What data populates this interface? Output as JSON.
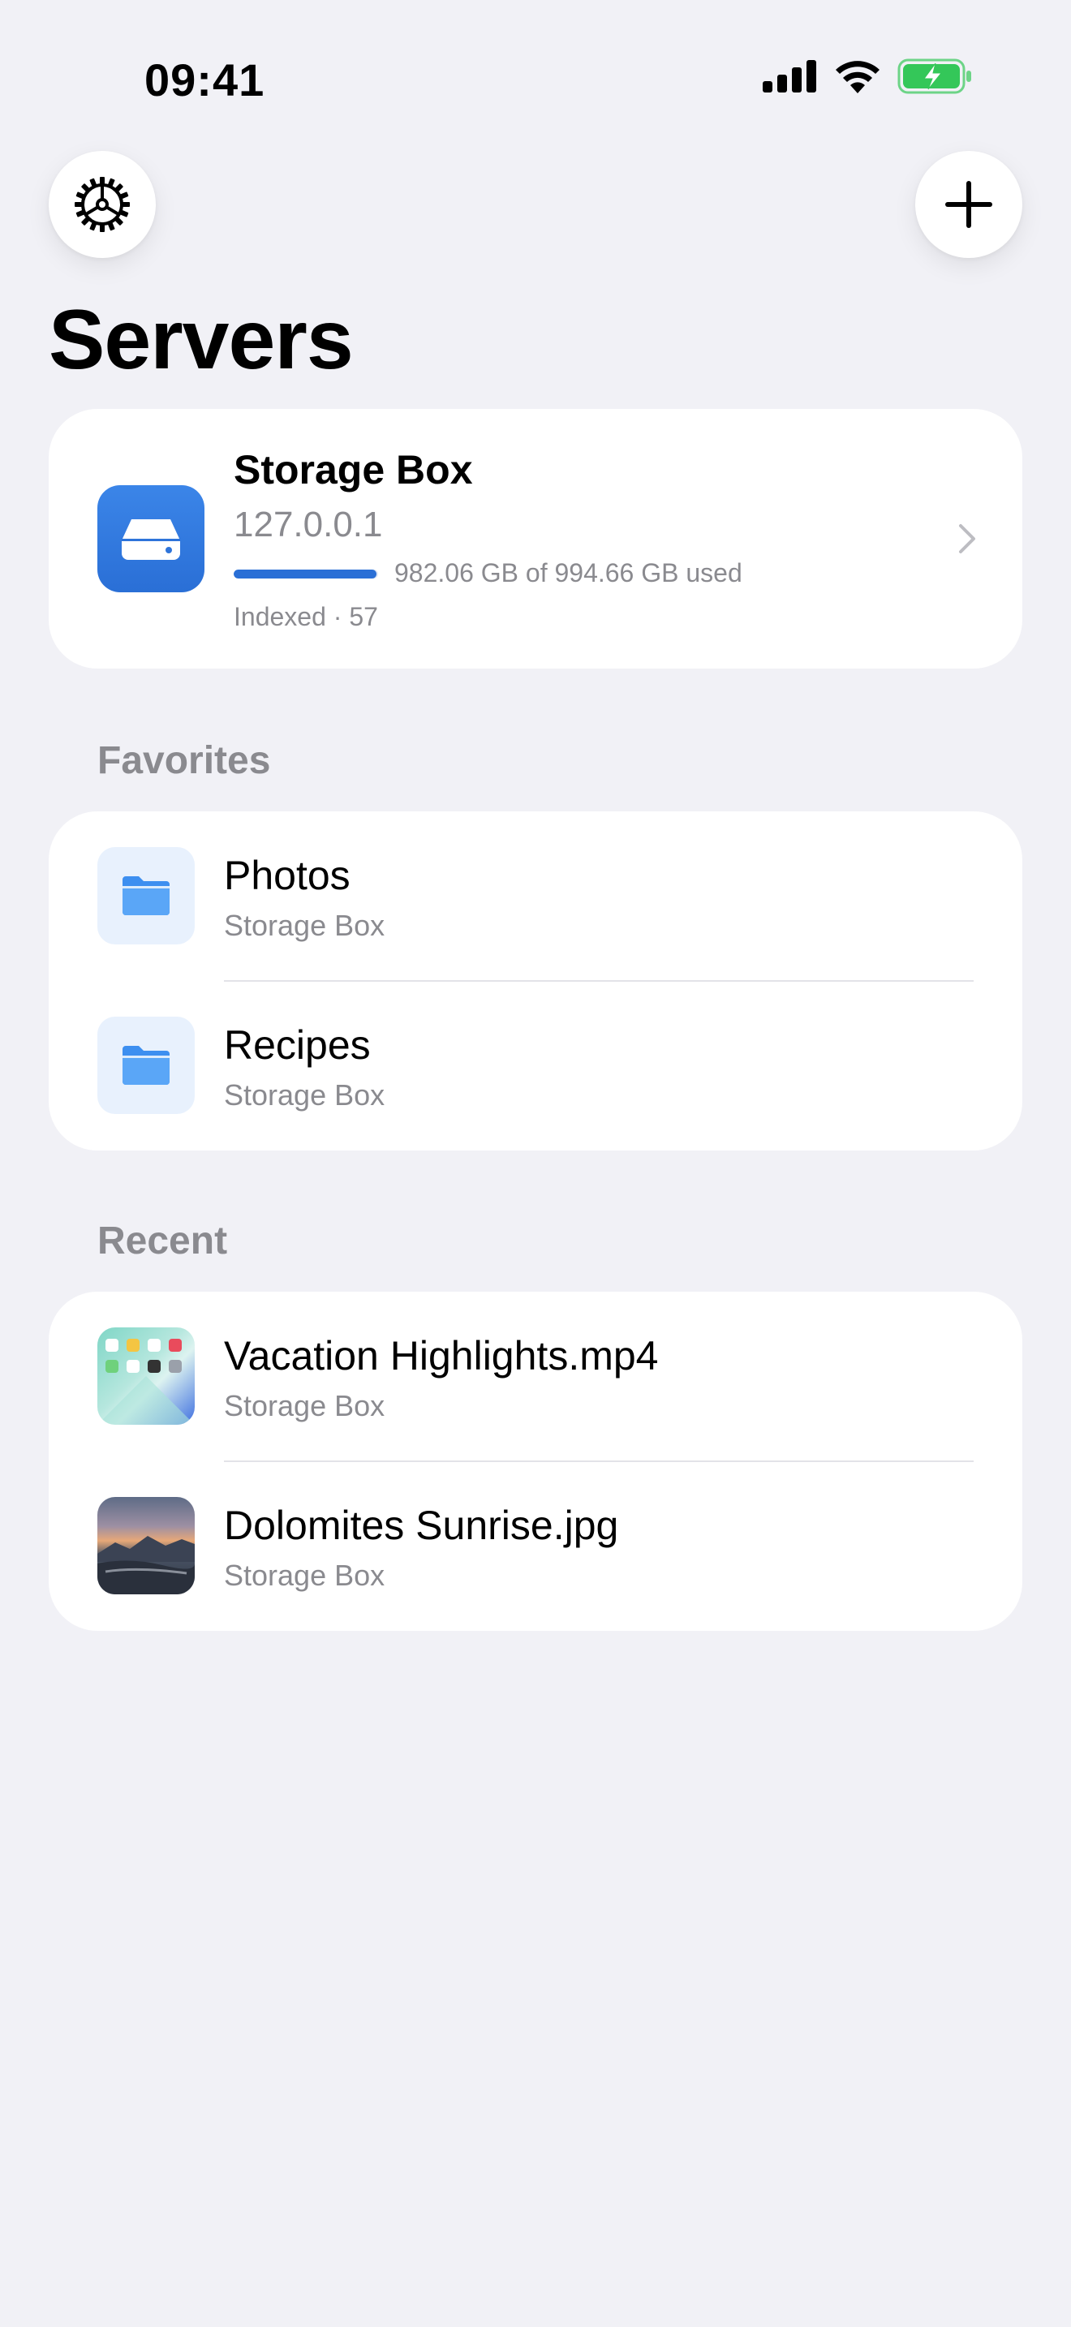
{
  "status_bar": {
    "time": "09:41"
  },
  "header": {
    "title": "Servers"
  },
  "server": {
    "name": "Storage Box",
    "address": "127.0.0.1",
    "usage_text": "982.06 GB of 994.66 GB used",
    "usage_fraction": 0.987,
    "indexed_text": "Indexed · 57"
  },
  "favorites": {
    "title": "Favorites",
    "items": [
      {
        "name": "Photos",
        "server": "Storage Box"
      },
      {
        "name": "Recipes",
        "server": "Storage Box"
      }
    ]
  },
  "recent": {
    "title": "Recent",
    "items": [
      {
        "name": "Vacation Highlights.mp4",
        "server": "Storage Box"
      },
      {
        "name": "Dolomites Sunrise.jpg",
        "server": "Storage Box"
      }
    ]
  },
  "colors": {
    "accent": "#2A6FD6",
    "background": "#F1F1F6",
    "secondary_text": "#8A8A8F",
    "battery_green": "#34C759"
  },
  "icons": [
    "gear-icon",
    "plus-icon",
    "drive-icon",
    "chevron-right-icon",
    "folder-icon",
    "signal-icon",
    "wifi-icon",
    "battery-charging-icon"
  ]
}
